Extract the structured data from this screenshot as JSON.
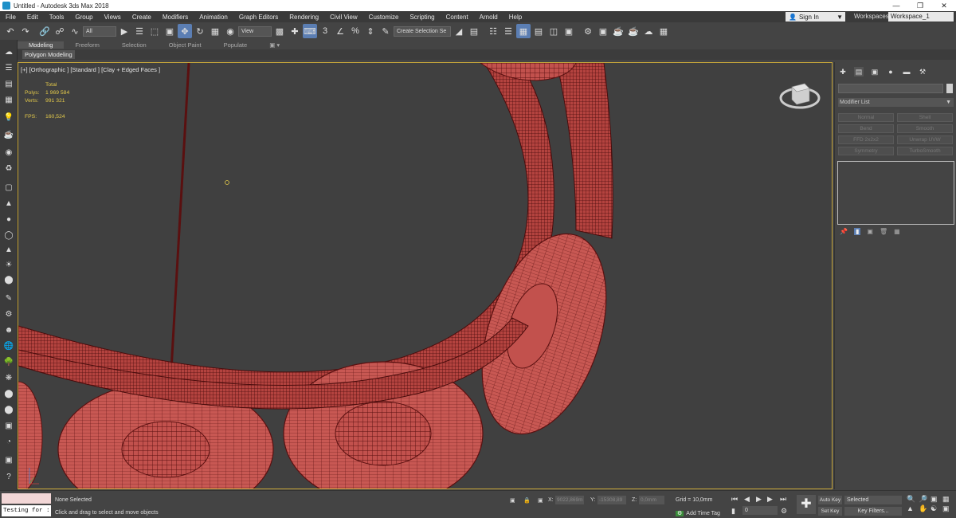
{
  "window": {
    "title": "Untitled - Autodesk 3ds Max 2018"
  },
  "menu": [
    "File",
    "Edit",
    "Tools",
    "Group",
    "Views",
    "Create",
    "Modifiers",
    "Animation",
    "Graph Editors",
    "Rendering",
    "Civil View",
    "Customize",
    "Scripting",
    "Content",
    "Arnold",
    "Help"
  ],
  "account": {
    "signin_label": "Sign In",
    "workspaces_label": "Workspaces:",
    "workspace_value": "Workspace_1"
  },
  "toolbar": {
    "filter_value": "All",
    "refcoord_value": "View",
    "selection_set_value": "Create Selection Se"
  },
  "ribbon": {
    "tabs": [
      "Modeling",
      "Freeform",
      "Selection",
      "Object Paint",
      "Populate"
    ],
    "panel_label": "Polygon Modeling"
  },
  "viewport": {
    "label": "[+] [Orthographic ] [Standard ] [Clay + Edged Faces ]",
    "stats": {
      "header": "Total",
      "polys_label": "Polys:",
      "polys_value": "1 969 584",
      "verts_label": "Verts:",
      "verts_value": "991 321",
      "fps_label": "FPS:",
      "fps_value": "160,524"
    }
  },
  "command_panel": {
    "modifier_list_label": "Modifier List",
    "modifier_buttons": [
      "Normal",
      "Shell",
      "Bend",
      "Smooth",
      "FFD 2x2x2",
      "Unwrap UVW",
      "Symmetry",
      "TurboSmooth"
    ]
  },
  "status": {
    "maxscript_value": "Testing for :",
    "selection_text": "None Selected",
    "prompt_text": "Click and drag to select and move objects",
    "x_label": "X:",
    "x_value": "9022,869m",
    "y_label": "Y:",
    "y_value": "-15308,89",
    "z_label": "Z:",
    "z_value": "0,0mm",
    "grid_text": "Grid = 10,0mm",
    "add_time_tag": "Add Time Tag",
    "frame_value": "0",
    "auto_key": "Auto Key",
    "set_key": "Set Key",
    "selected_value": "Selected",
    "key_filters": "Key Filters..."
  },
  "colors": {
    "accent": "#5b7eb3",
    "viewport_border": "#c8a73a",
    "mesh": "#c2514d",
    "wire": "#5a1010"
  }
}
